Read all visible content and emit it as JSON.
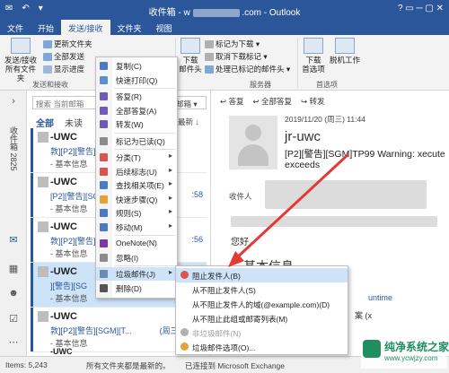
{
  "window": {
    "title_prefix": "收件箱 - w",
    "title_suffix": ".com - Outlook",
    "controls": "?  ▭  ─  ▢  ✕"
  },
  "tabs": [
    "文件",
    "开始",
    "发送/接收",
    "文件夹",
    "视图"
  ],
  "ribbon": {
    "send_all_label": "发送/接收\n所有文件夹",
    "update_folder": "更新文件夹",
    "send_all": "全部发送",
    "show_progress": "显示进度",
    "group_send_receive": "发送和接收",
    "download_headers": "下载\n邮件头",
    "mark_download": "标记为下载",
    "unmark_download": "取消下载标记",
    "process_headers": "处理已标记的邮件头",
    "group_server": "服务器",
    "download_prefs": "下载\n首选项",
    "work_offline": "脱机工作",
    "group_prefs": "首选项"
  },
  "nav": {
    "inbox_label": "收件箱 2825"
  },
  "list": {
    "search_placeholder": "搜索 当前邮箱",
    "search_scope": "当前邮箱 ▾",
    "filter_all": "全部",
    "filter_unread": "未读",
    "sort_label": "最新 ↓",
    "items": [
      {
        "sender": "-UWC",
        "subject": "敦][P2][警告]",
        "preview": "- 基本信息",
        "time": ""
      },
      {
        "sender": "-UWC",
        "subject": "[P2][警告][SG",
        "preview": "- 基本信息",
        "time": ":58"
      },
      {
        "sender": "-UWC",
        "subject": "敦][P2][警告]",
        "preview": "- 基本信息",
        "time": ":56"
      },
      {
        "sender": "-UWC",
        "subject": "][警告][SG",
        "preview": "- 基本信息",
        "time": ""
      },
      {
        "sender": "-UWC",
        "subject": "敦][P2][警告][SGM][T...",
        "preview": "- 基本信息",
        "time": "(周三) 11:44"
      },
      {
        "sender": "-UWC",
        "subject": "",
        "preview": "",
        "time": ""
      }
    ]
  },
  "reading": {
    "reply": "答复",
    "reply_all": "全部答复",
    "forward": "转发",
    "date": "2019/11/20 (周三) 11:44",
    "sender": "jr-uwc",
    "subject": "[P2][警告][SGM]TP99 Warning: xecute exceeds",
    "to_label": "收件人",
    "greeting": "您好，",
    "heading": "基本信息",
    "line1": "untime",
    "line2": "案 (x"
  },
  "context_menu": {
    "items": [
      {
        "label": "复制(C)",
        "color": "#4a7bc4",
        "submenu": false
      },
      {
        "label": "快速打印(Q)",
        "color": "#5a8fd0",
        "submenu": false
      },
      {
        "label": "答复(R)",
        "color": "#6f5ab6",
        "submenu": false
      },
      {
        "label": "全部答复(A)",
        "color": "#6f5ab6",
        "submenu": false
      },
      {
        "label": "转发(W)",
        "color": "#6f5ab6",
        "submenu": false
      },
      {
        "label": "标记为已读(Q)",
        "color": "#8c8c8c",
        "submenu": false
      },
      {
        "label": "分类(T)",
        "color": "#d9534f",
        "submenu": true
      },
      {
        "label": "后续标志(U)",
        "color": "#d9534f",
        "submenu": true
      },
      {
        "label": "查找相关项(E)",
        "color": "#4a7bc4",
        "submenu": true
      },
      {
        "label": "快速步骤(Q)",
        "color": "#e5a13a",
        "submenu": true
      },
      {
        "label": "规则(S)",
        "color": "#4a7bc4",
        "submenu": true
      },
      {
        "label": "移动(M)",
        "color": "#4a7bc4",
        "submenu": true
      },
      {
        "label": "OneNote(N)",
        "color": "#7b3aa8",
        "submenu": false
      },
      {
        "label": "忽略(I)",
        "color": "#8c8c8c",
        "submenu": false
      },
      {
        "label": "垃圾邮件(J)",
        "color": "#6a8bb8",
        "submenu": true
      },
      {
        "label": "删除(D)",
        "color": "#555555",
        "submenu": false
      }
    ]
  },
  "submenu": {
    "items": [
      {
        "label": "阻止发件人(B)",
        "disabled": false
      },
      {
        "label": "从不阻止发件人(S)",
        "disabled": false
      },
      {
        "label": "从不阻止发件人的域(@example.com)(D)",
        "disabled": false
      },
      {
        "label": "从不阻止此组或邮寄列表(M)",
        "disabled": false
      },
      {
        "label": "非垃圾邮件(N)",
        "disabled": true
      },
      {
        "label": "垃圾邮件选项(O)...",
        "disabled": false
      }
    ]
  },
  "status": {
    "items": "Items: 5,243",
    "sync": "所有文件夹都是最新的。",
    "connected": "已连接到 Microsoft Exchange"
  },
  "watermark": {
    "title": "纯净系统之家",
    "url": "www.ycwjzy.com"
  },
  "colors": {
    "brand": "#2b579a",
    "annotation_arrow": "#e53935",
    "selection": "#cde3f7",
    "menu_highlight": "#cfe3f8"
  }
}
